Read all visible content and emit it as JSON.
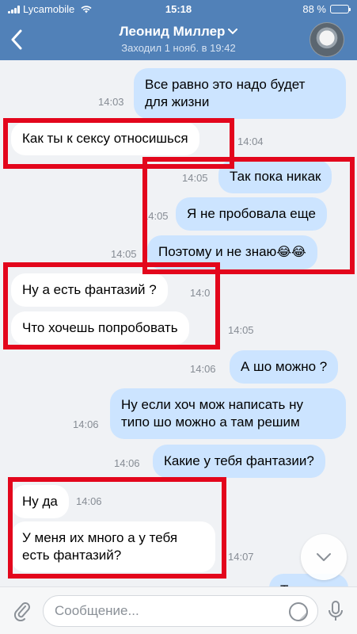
{
  "status_bar": {
    "carrier": "Lycamobile",
    "time": "15:18",
    "battery": "88 %",
    "battery_level": 0.88
  },
  "header": {
    "title": "Леонид Миллер",
    "subtitle": "Заходил 1 нояб. в 19:42",
    "back_icon": "chevron-left-icon",
    "dropdown_icon": "chevron-down-icon"
  },
  "messages": [
    {
      "dir": "out",
      "text": "Все равно это надо будет\nдля жизни",
      "time": "14:03"
    },
    {
      "dir": "in",
      "text": "Как ты к сексу относишься",
      "time": "14:04"
    },
    {
      "dir": "out",
      "text": "Так пока никак",
      "time": "14:05"
    },
    {
      "dir": "out",
      "text": "Я не пробовала еще",
      "time": "14:05"
    },
    {
      "dir": "out",
      "text": "Поэтому и не знаю",
      "emoji": "😂😂",
      "time": "14:05"
    },
    {
      "dir": "in",
      "text": "Ну а есть фантазий ?",
      "time": "14:0"
    },
    {
      "dir": "in",
      "text": "Что хочешь попробовать",
      "time": "14:05"
    },
    {
      "dir": "out",
      "text": "А шо можно ?",
      "time": "14:06"
    },
    {
      "dir": "out",
      "text": "Ну если хоч мож написать ну\nтипо шо можно а там решим",
      "time": "14:06"
    },
    {
      "dir": "out",
      "text": "Какие у тебя фантазии?",
      "time": "14:06"
    },
    {
      "dir": "in",
      "text": "Ну да",
      "time": "14:06"
    },
    {
      "dir": "in",
      "text": "У меня их много а у тебя\nесть фантазий?",
      "time": "14:07"
    },
    {
      "dir": "out",
      "text": "Т",
      "time": ""
    }
  ],
  "compose": {
    "placeholder": "Сообщение..."
  },
  "colors": {
    "header": "#5181b8",
    "outgoing": "#cce4ff",
    "incoming": "#ffffff",
    "highlight": "#e3061c"
  }
}
